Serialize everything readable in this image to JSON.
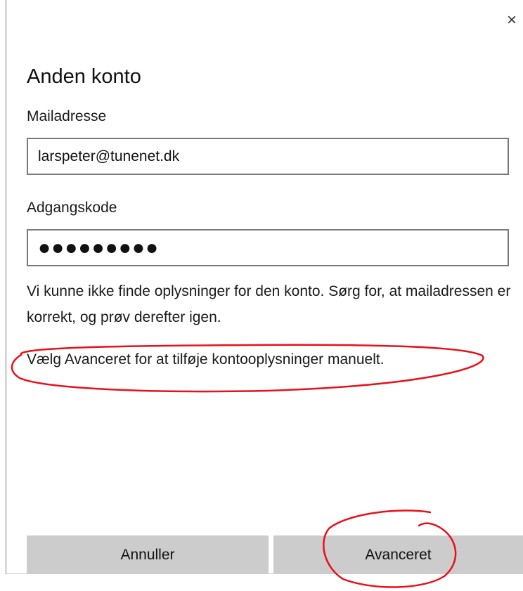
{
  "dialog": {
    "close_glyph": "×",
    "title": "Anden konto",
    "email_label": "Mailadresse",
    "email_value": "larspeter@tunenet.dk",
    "password_label": "Adgangskode",
    "password_value": "●●●●●●●●●",
    "error_message": "Vi kunne ikke finde oplysninger for den konto. Sørg for, at mailadressen er korrekt, og prøv derefter igen.",
    "hint_message": "Vælg Avanceret for at tilføje kontooplysninger manuelt.",
    "cancel_label": "Annuller",
    "advanced_label": "Avanceret"
  },
  "annotation": {
    "color": "#e8101a",
    "marks": [
      "hint-circle",
      "advanced-button-circle"
    ]
  },
  "colors": {
    "button_bg": "#cccccc",
    "input_border": "#7a7a7a",
    "background": "#ffffff"
  }
}
